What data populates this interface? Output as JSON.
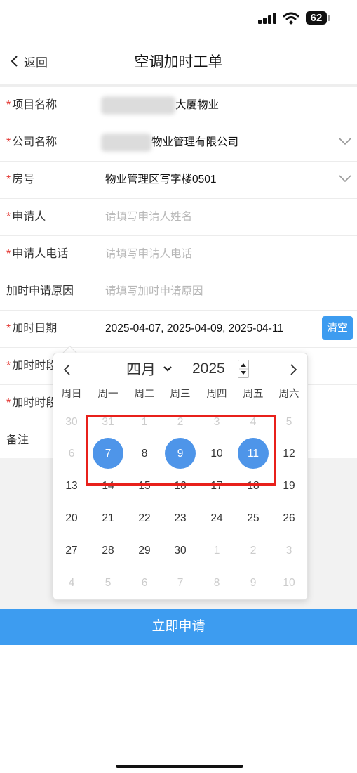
{
  "status": {
    "battery": "62"
  },
  "nav": {
    "back_label": "返回",
    "title": "空调加时工单"
  },
  "form": {
    "project": {
      "label": "项目名称",
      "value_suffix": "大厦物业"
    },
    "company": {
      "label": "公司名称",
      "value_suffix": "物业管理有限公司"
    },
    "room": {
      "label": "房号",
      "value": "物业管理区写字楼0501"
    },
    "applicant": {
      "label": "申请人",
      "placeholder": "请填写申请人姓名"
    },
    "phone": {
      "label": "申请人电话",
      "placeholder": "请填写申请人电话"
    },
    "reason": {
      "label": "加时申请原因",
      "placeholder": "请填写加时申请原因"
    },
    "date": {
      "label": "加时日期",
      "value": "2025-04-07, 2025-04-09, 2025-04-11",
      "clear_label": "清空"
    },
    "time1": {
      "label": "加时时段"
    },
    "time2": {
      "label": "加时时段"
    },
    "remark": {
      "label": "备注"
    }
  },
  "calendar": {
    "month": "四月",
    "year": "2025",
    "weekdays": [
      "周日",
      "周一",
      "周二",
      "周三",
      "周四",
      "周五",
      "周六"
    ],
    "weeks": [
      [
        {
          "d": "30",
          "m": true
        },
        {
          "d": "31",
          "m": true
        },
        {
          "d": "1",
          "m": true
        },
        {
          "d": "2",
          "m": true
        },
        {
          "d": "3",
          "m": true
        },
        {
          "d": "4",
          "m": true
        },
        {
          "d": "5",
          "m": true
        }
      ],
      [
        {
          "d": "6",
          "m": true
        },
        {
          "d": "7",
          "s": true
        },
        {
          "d": "8"
        },
        {
          "d": "9",
          "s": true
        },
        {
          "d": "10"
        },
        {
          "d": "11",
          "s": true
        },
        {
          "d": "12"
        }
      ],
      [
        {
          "d": "13"
        },
        {
          "d": "14"
        },
        {
          "d": "15"
        },
        {
          "d": "16"
        },
        {
          "d": "17"
        },
        {
          "d": "18"
        },
        {
          "d": "19"
        }
      ],
      [
        {
          "d": "20"
        },
        {
          "d": "21"
        },
        {
          "d": "22"
        },
        {
          "d": "23"
        },
        {
          "d": "24"
        },
        {
          "d": "25"
        },
        {
          "d": "26"
        }
      ],
      [
        {
          "d": "27"
        },
        {
          "d": "28"
        },
        {
          "d": "29"
        },
        {
          "d": "30"
        },
        {
          "d": "1",
          "m": true
        },
        {
          "d": "2",
          "m": true
        },
        {
          "d": "3",
          "m": true
        }
      ],
      [
        {
          "d": "4",
          "m": true
        },
        {
          "d": "5",
          "m": true
        },
        {
          "d": "6",
          "m": true
        },
        {
          "d": "7",
          "m": true
        },
        {
          "d": "8",
          "m": true
        },
        {
          "d": "9",
          "m": true
        },
        {
          "d": "10",
          "m": true
        }
      ]
    ]
  },
  "submit_label": "立即申请",
  "colors": {
    "primary": "#3d9cf0",
    "selected_day": "#4e95e9",
    "required": "#e3342f",
    "highlight": "#e8201b"
  }
}
